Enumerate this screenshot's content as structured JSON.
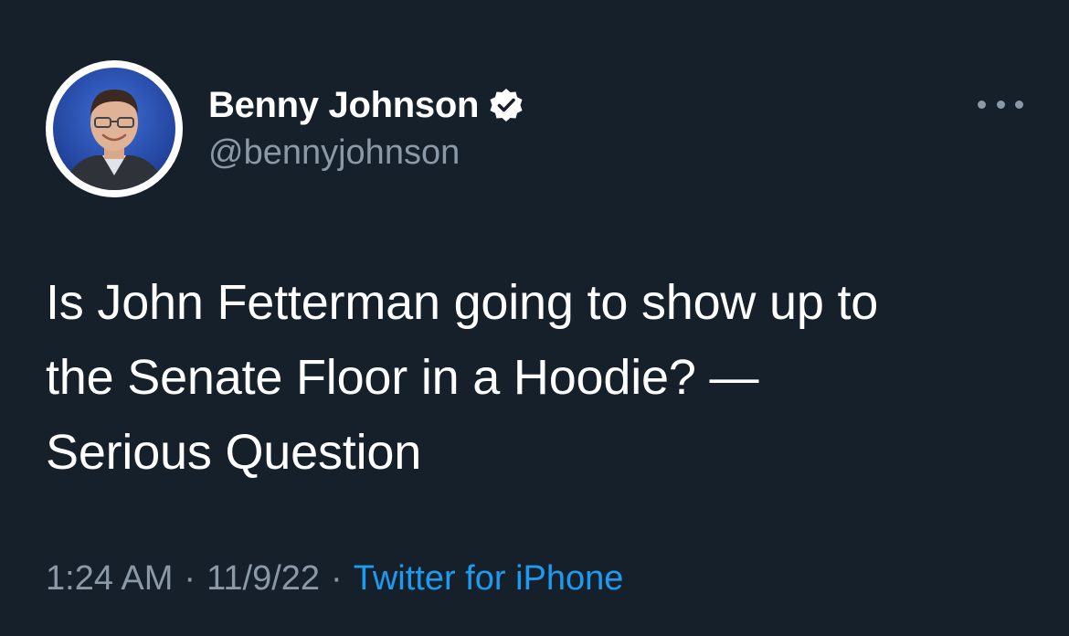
{
  "author": {
    "display_name": "Benny Johnson",
    "handle": "@bennyjohnson",
    "verified": true
  },
  "tweet": {
    "lines": [
      "Is John Fetterman going to show up to",
      "the Senate Floor in a Hoodie? —",
      "Serious Question"
    ]
  },
  "meta": {
    "time": "1:24 AM",
    "separator": "·",
    "date": "11/9/22",
    "source": "Twitter for iPhone"
  },
  "icons": {
    "verified": "verified-badge-icon",
    "more": "more-options-icon"
  },
  "colors": {
    "background": "#15202b",
    "text_primary": "#ffffff",
    "text_secondary": "#8b98a5",
    "link": "#1d9bf0"
  }
}
